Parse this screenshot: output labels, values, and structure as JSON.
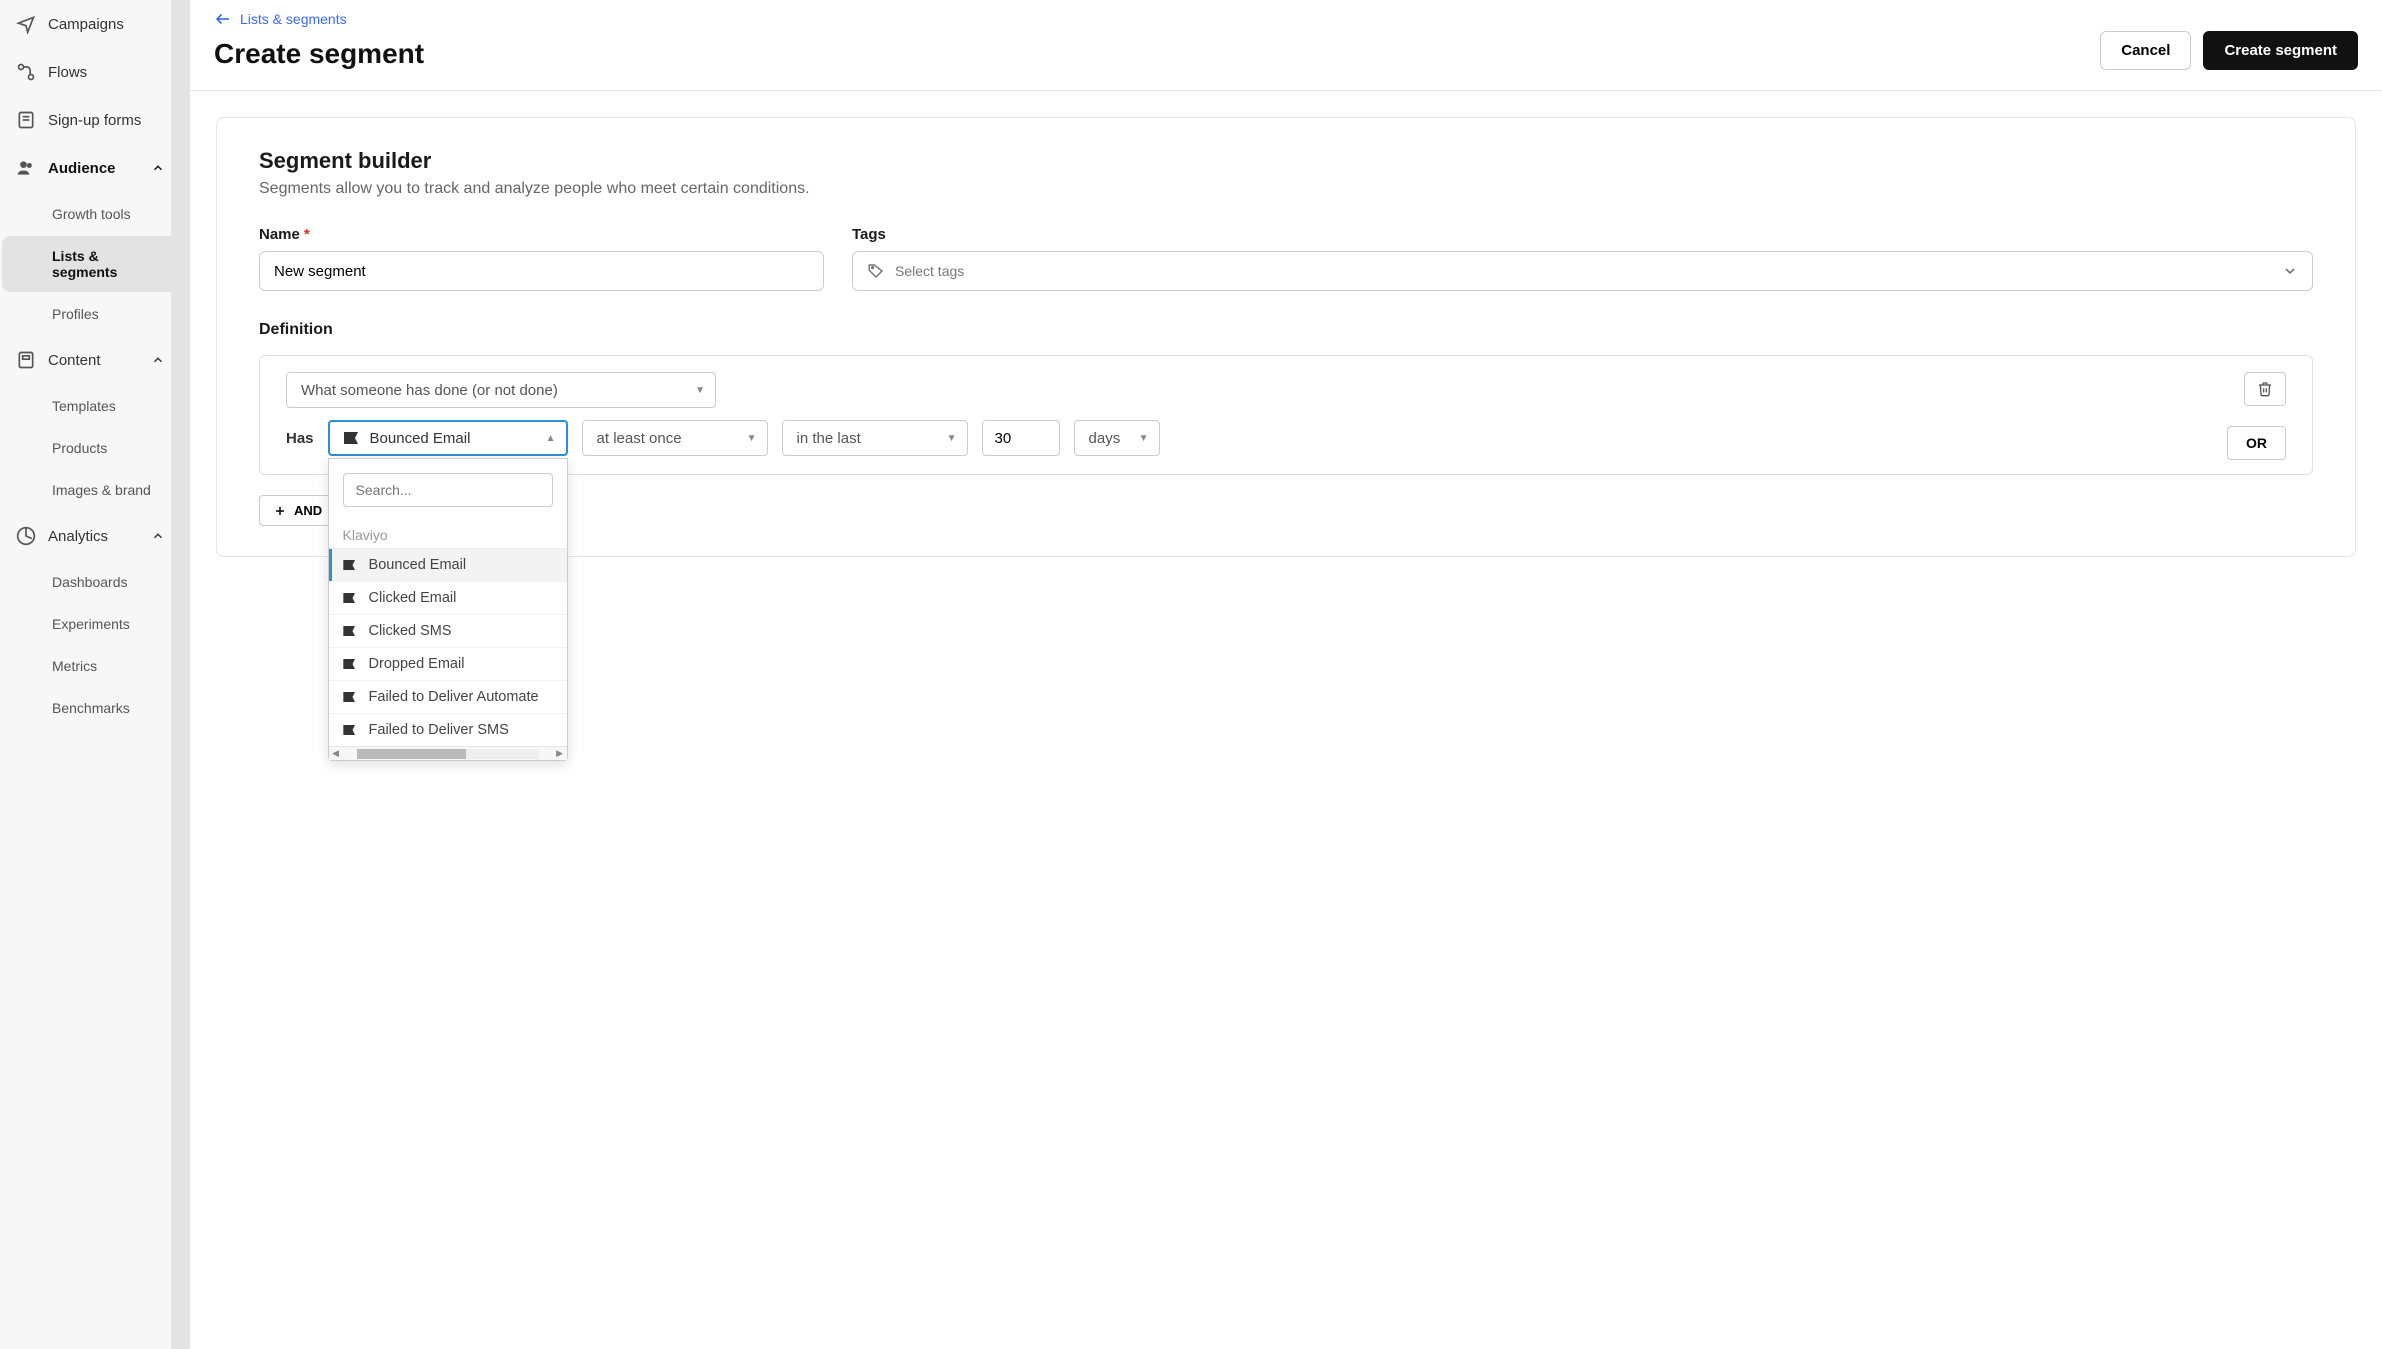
{
  "sidebar": {
    "items": [
      {
        "label": "Campaigns",
        "icon": "send"
      },
      {
        "label": "Flows",
        "icon": "flows"
      },
      {
        "label": "Sign-up forms",
        "icon": "form"
      },
      {
        "label": "Audience",
        "icon": "audience",
        "expanded": true
      },
      {
        "label": "Content",
        "icon": "content",
        "expanded": true
      },
      {
        "label": "Analytics",
        "icon": "analytics",
        "expanded": true
      }
    ],
    "audience_sub": [
      "Growth tools",
      "Lists & segments",
      "Profiles"
    ],
    "content_sub": [
      "Templates",
      "Products",
      "Images & brand"
    ],
    "analytics_sub": [
      "Dashboards",
      "Experiments",
      "Metrics",
      "Benchmarks"
    ]
  },
  "breadcrumb": {
    "label": "Lists & segments"
  },
  "page_title": "Create segment",
  "buttons": {
    "cancel": "Cancel",
    "create": "Create segment"
  },
  "builder": {
    "title": "Segment builder",
    "subtitle": "Segments allow you to track and analyze people who meet certain conditions.",
    "name_label": "Name",
    "name_value": "New segment",
    "tags_label": "Tags",
    "tags_placeholder": "Select tags",
    "definition_label": "Definition",
    "condition_type": "What someone has done (or not done)",
    "has_label": "Has",
    "metric_value": "Bounced Email",
    "frequency": "at least once",
    "period": "in the last",
    "number": "30",
    "unit": "days",
    "or_label": "OR",
    "and_label": "AND"
  },
  "dropdown": {
    "search_placeholder": "Search...",
    "group": "Klaviyo",
    "options": [
      "Bounced Email",
      "Clicked Email",
      "Clicked SMS",
      "Dropped Email",
      "Failed to Deliver Automate",
      "Failed to Deliver SMS"
    ]
  }
}
